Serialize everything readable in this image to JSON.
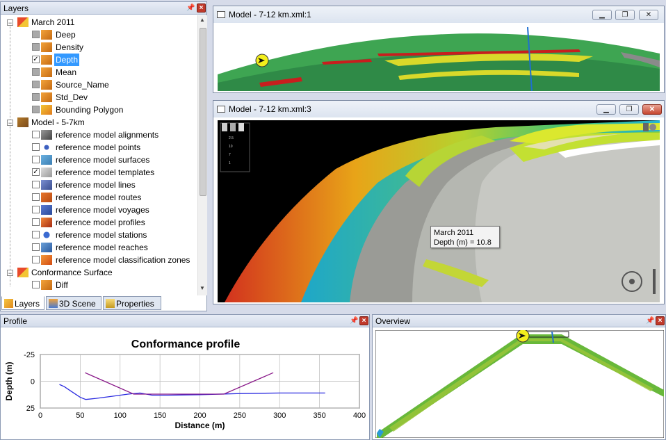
{
  "layers_panel": {
    "title": "Layers",
    "tree": [
      {
        "label": "March 2011",
        "expander": "−",
        "check": "",
        "icon": "grid-icon"
      },
      {
        "label": "Deep",
        "check": "gray",
        "icon": "layer-icon"
      },
      {
        "label": "Density",
        "check": "gray",
        "icon": "layer-icon"
      },
      {
        "label": "Depth",
        "check": "checked",
        "icon": "layer-icon",
        "selected": true
      },
      {
        "label": "Mean",
        "check": "gray",
        "icon": "layer-icon"
      },
      {
        "label": "Source_Name",
        "check": "gray",
        "icon": "layer-icon"
      },
      {
        "label": "Std_Dev",
        "check": "gray",
        "icon": "layer-icon"
      },
      {
        "label": "Bounding Polygon",
        "check": "gray",
        "icon": "polygon-icon"
      },
      {
        "label": "Model - 5-7km",
        "expander": "−",
        "check": "",
        "icon": "model-icon"
      },
      {
        "label": "reference model alignments",
        "check": "unchecked",
        "icon": "alignment-icon"
      },
      {
        "label": "reference model points",
        "check": "unchecked",
        "icon": "point-icon"
      },
      {
        "label": "reference model surfaces",
        "check": "unchecked",
        "icon": "surface-icon"
      },
      {
        "label": "reference model templates",
        "check": "checked",
        "icon": "template-icon"
      },
      {
        "label": "reference model lines",
        "check": "unchecked",
        "icon": "line-icon"
      },
      {
        "label": "reference model routes",
        "check": "unchecked",
        "icon": "route-icon"
      },
      {
        "label": "reference model voyages",
        "check": "unchecked",
        "icon": "voyage-icon"
      },
      {
        "label": "reference model profiles",
        "check": "unchecked",
        "icon": "profile-icon"
      },
      {
        "label": "reference model stations",
        "check": "unchecked",
        "icon": "station-icon"
      },
      {
        "label": "reference model reaches",
        "check": "unchecked",
        "icon": "reach-icon"
      },
      {
        "label": "reference model classification zones",
        "check": "unchecked",
        "icon": "zone-icon"
      },
      {
        "label": "Conformance Surface",
        "expander": "−",
        "check": "",
        "icon": "grid-icon"
      },
      {
        "label": "Diff",
        "check": "unchecked",
        "icon": "layer-icon"
      }
    ],
    "tabs": [
      "Layers",
      "3D Scene",
      "Properties"
    ]
  },
  "model_top": {
    "title": "Model - 7-12 km.xml:1"
  },
  "model_main": {
    "title": "Model - 7-12 km.xml:3",
    "tooltip_line1": "March 2011",
    "tooltip_line2": "Depth (m) = 10.8",
    "legend_ticks": [
      "2.5",
      "10",
      "7",
      "1"
    ]
  },
  "profile_panel": {
    "title": "Profile",
    "chart_data": {
      "type": "line",
      "title": "Conformance profile",
      "xlabel": "Distance (m)",
      "ylabel": "Depth (m)",
      "xlim": [
        0,
        400
      ],
      "ylim": [
        25,
        -25
      ],
      "xticks": [
        "0",
        "50",
        "100",
        "150",
        "200",
        "250",
        "300",
        "350",
        "400"
      ],
      "yticks": [
        "-25",
        "0",
        "25"
      ],
      "series": [
        {
          "color": "#2a2ae0",
          "x": [
            24,
            30,
            40,
            50,
            57,
            70,
            90,
            110,
            125,
            140,
            160,
            200,
            250,
            300,
            330,
            357
          ],
          "y": [
            3,
            5,
            10,
            15,
            17,
            16,
            14,
            12,
            11,
            13,
            13,
            12.5,
            11.5,
            11,
            11,
            11
          ]
        },
        {
          "color": "#8a1a8a",
          "x": [
            56,
            117,
            230,
            292
          ],
          "y": [
            -8,
            12,
            12,
            -8
          ]
        }
      ]
    }
  },
  "overview_panel": {
    "title": "Overview"
  },
  "colors": {
    "accent": "#3399ff",
    "seabed_green": "#3fa34d",
    "flag_red": "#d62020"
  }
}
